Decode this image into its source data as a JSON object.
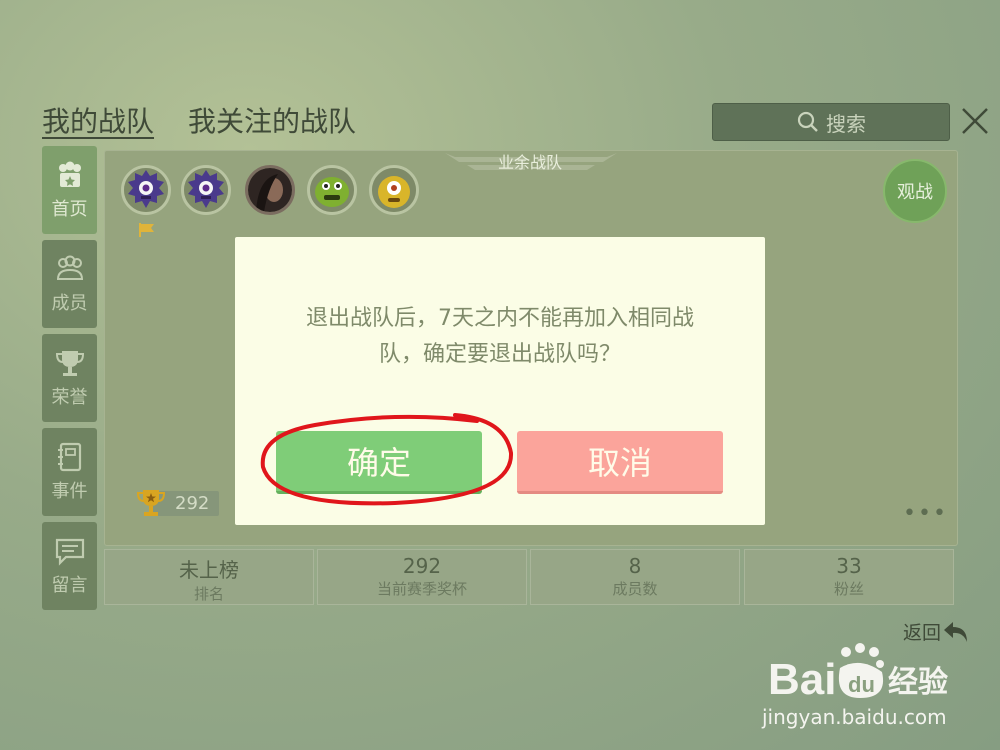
{
  "header": {
    "tab_mine": "我的战队",
    "tab_followed": "我关注的战队",
    "search_label": "搜索",
    "close_icon": "close-icon"
  },
  "sidebar": {
    "items": [
      {
        "label": "首页",
        "icon": "team-home-icon",
        "active": true
      },
      {
        "label": "成员",
        "icon": "members-icon",
        "active": false
      },
      {
        "label": "荣誉",
        "icon": "trophy-icon",
        "active": false
      },
      {
        "label": "事件",
        "icon": "notebook-icon",
        "active": false
      },
      {
        "label": "留言",
        "icon": "message-icon",
        "active": false
      }
    ]
  },
  "team": {
    "type_label": "业余战队",
    "watch_label": "观战",
    "trophies": "292",
    "more": "•••",
    "avatars": [
      "purple-monster",
      "purple-monster",
      "user-photo",
      "green-monster",
      "yellow-monster"
    ]
  },
  "stats": [
    {
      "value": "未上榜",
      "label": "排名"
    },
    {
      "value": "292",
      "label": "当前赛季奖杯"
    },
    {
      "value": "8",
      "label": "成员数"
    },
    {
      "value": "33",
      "label": "粉丝"
    }
  ],
  "footer": {
    "back_label": "返回"
  },
  "dialog": {
    "line1": "退出战队后，7天之内不能再加入相同战",
    "line2": "队，确定要退出战队吗？",
    "confirm_label": "确定",
    "cancel_label": "取消"
  },
  "watermark": {
    "logo_text": "Bai",
    "logo_du": "du",
    "logo_cn": "经验",
    "url": "jingyan.baidu.com"
  },
  "colors": {
    "confirm": "#7fcd78",
    "cancel": "#fba49b",
    "annotation": "#e0161b"
  }
}
